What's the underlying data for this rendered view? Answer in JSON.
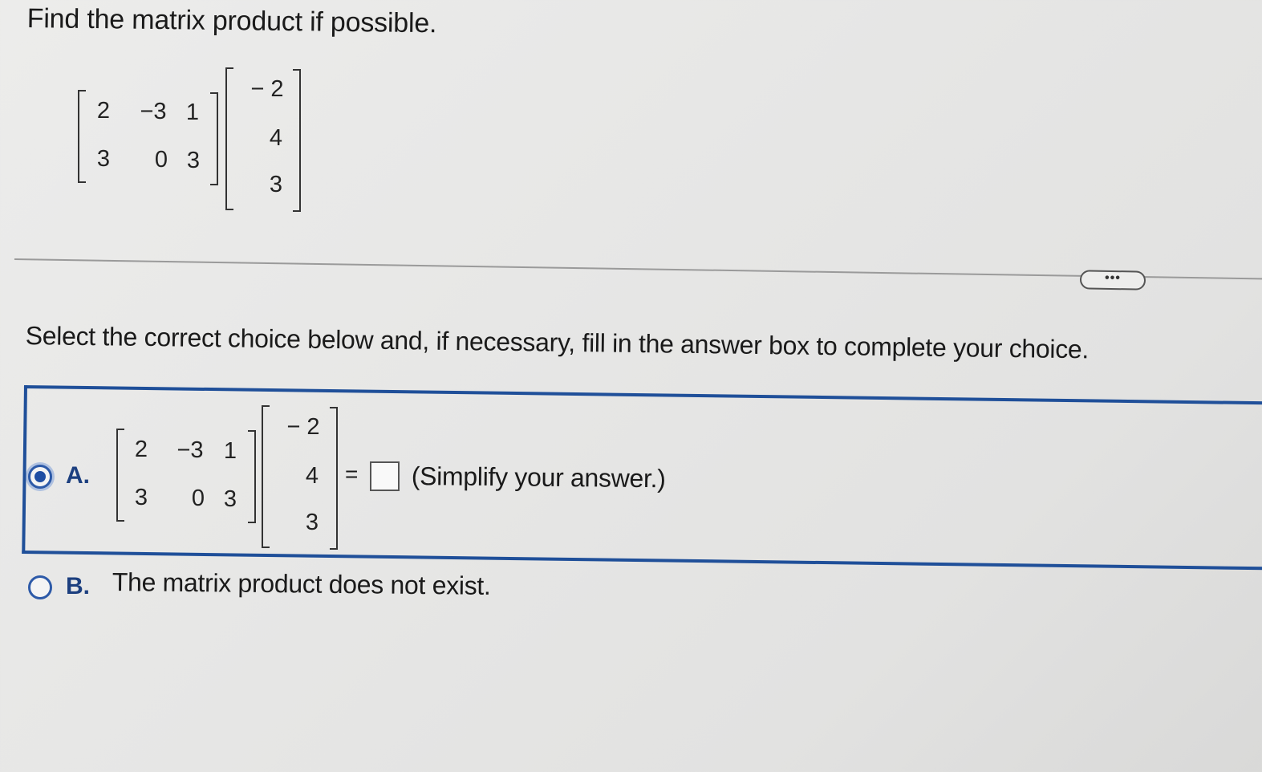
{
  "question": {
    "prompt": "Find the matrix product if possible.",
    "matrix_a": [
      [
        "2",
        "−3",
        "1"
      ],
      [
        "3",
        "0",
        "3"
      ]
    ],
    "matrix_b": [
      "− 2",
      "4",
      "3"
    ]
  },
  "divider": {
    "more_label": "•••"
  },
  "instruction": "Select the correct choice below and, if necessary, fill in the answer box to complete your choice.",
  "choices": {
    "a": {
      "letter": "A.",
      "selected": true,
      "matrix_a": [
        [
          "2",
          "−3",
          "1"
        ],
        [
          "3",
          "0",
          "3"
        ]
      ],
      "matrix_b": [
        "− 2",
        "4",
        "3"
      ],
      "equals": "=",
      "answer_value": "",
      "hint": "(Simplify your answer.)"
    },
    "b": {
      "letter": "B.",
      "selected": false,
      "text": "The matrix product does not exist."
    }
  },
  "colors": {
    "accent": "#1f4f99",
    "radio_fill": "#1f4ea3"
  }
}
